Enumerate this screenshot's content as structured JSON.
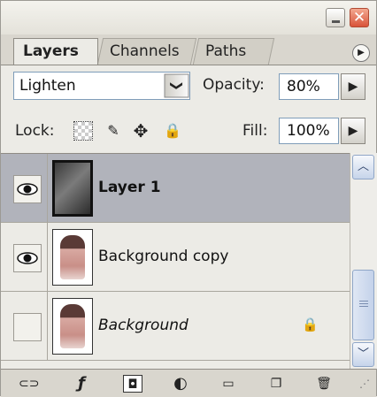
{
  "window": {
    "close_glyph": "✕",
    "icons": [
      "minimize-icon",
      "close-icon"
    ]
  },
  "tabs": [
    {
      "label": "Layers",
      "active": true
    },
    {
      "label": "Channels",
      "active": false
    },
    {
      "label": "Paths",
      "active": false
    }
  ],
  "panel_menu_glyph": "▶",
  "blend_mode": {
    "value": "Lighten",
    "arrow": "❯"
  },
  "opacity": {
    "label": "Opacity:",
    "value": "80%"
  },
  "lock": {
    "label": "Lock:",
    "icons": [
      "lock-transparent-pixels-icon",
      "lock-image-pixels-icon",
      "lock-position-icon",
      "lock-all-icon"
    ],
    "glyphs": {
      "image": "✎",
      "position": "✥",
      "all": "🔒"
    }
  },
  "fill": {
    "label": "Fill:",
    "value": "100%"
  },
  "stepper_glyph": "▶",
  "layers": [
    {
      "name": "Layer 1",
      "visible": true,
      "selected": true,
      "thumbnail": "dark-texture"
    },
    {
      "name": "Background copy",
      "visible": true,
      "selected": false,
      "thumbnail": "portrait-photo"
    },
    {
      "name": "Background",
      "visible": false,
      "selected": false,
      "thumbnail": "portrait-photo",
      "locked": true,
      "lock_glyph": "🔒"
    }
  ],
  "scrollbar": {
    "up_glyph": "︿",
    "down_glyph": "﹀"
  },
  "bottom_icons": [
    {
      "name": "link-layers-icon",
      "glyph": "⊂⊃"
    },
    {
      "name": "layer-style-icon",
      "glyph": "ƒ"
    },
    {
      "name": "layer-mask-icon",
      "glyph": "◘"
    },
    {
      "name": "adjustment-layer-icon",
      "glyph": "◐"
    },
    {
      "name": "new-group-icon",
      "glyph": "▭"
    },
    {
      "name": "new-layer-icon",
      "glyph": "❐"
    },
    {
      "name": "delete-layer-icon",
      "glyph": "🗑"
    },
    {
      "name": "resize-grip-icon",
      "glyph": "⋰"
    }
  ]
}
